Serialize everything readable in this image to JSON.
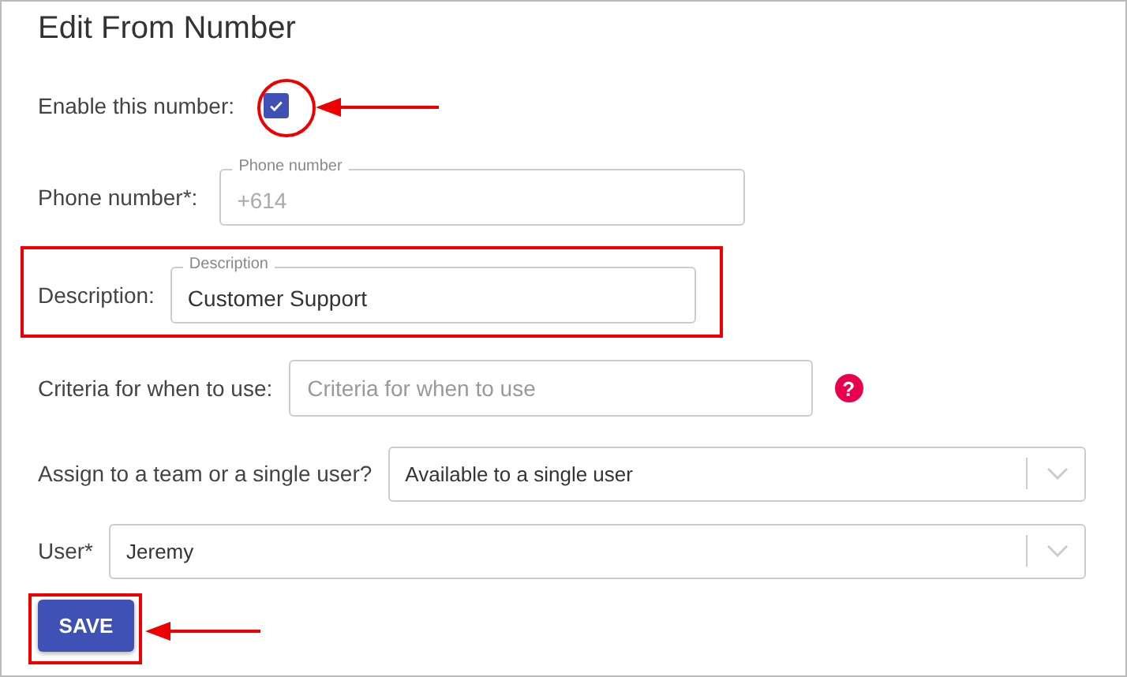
{
  "title": "Edit From Number",
  "form": {
    "enable": {
      "label": "Enable this number:",
      "checked": true
    },
    "phone": {
      "label": "Phone number*:",
      "floating_label": "Phone number",
      "value": "+614",
      "disabled": true
    },
    "description": {
      "label": "Description:",
      "floating_label": "Description",
      "value": "Customer Support"
    },
    "criteria": {
      "label": "Criteria for when to use:",
      "placeholder": "Criteria for when to use",
      "help": "?"
    },
    "assign": {
      "label": "Assign to a team or a single user?",
      "value": "Available to a single user"
    },
    "user": {
      "label": "User*",
      "value": "Jeremy"
    }
  },
  "buttons": [
    {
      "label": "SAVE"
    }
  ]
}
